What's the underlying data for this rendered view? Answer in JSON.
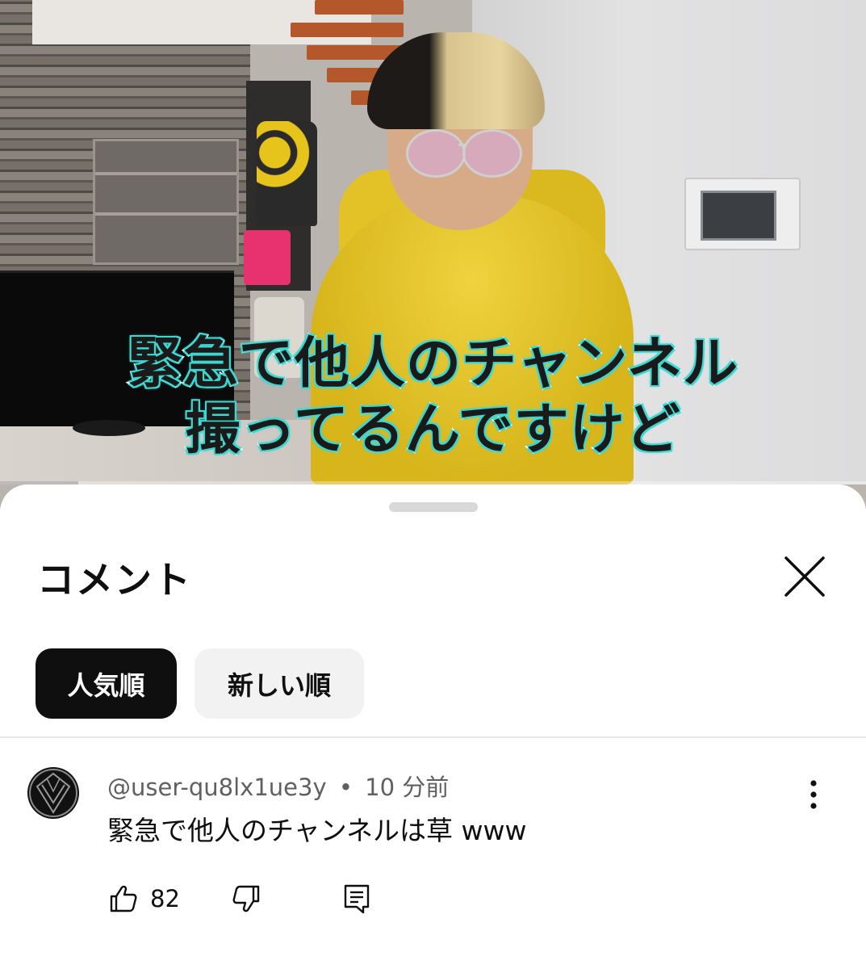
{
  "video": {
    "caption_line1": "緊急で他人のチャンネル",
    "caption_line2": "撮ってるんですけど",
    "progress": 0.09
  },
  "comments_panel": {
    "title": "コメント",
    "sort_chips": [
      {
        "label": "人気順",
        "selected": true
      },
      {
        "label": "新しい順",
        "selected": false
      }
    ],
    "comments": [
      {
        "author": "@user-qu8lx1ue3y",
        "separator": "•",
        "time": "10 分前",
        "text": "緊急で他人のチャンネルは草 www",
        "like_count": "82"
      }
    ]
  },
  "icons": {
    "close": "close-icon",
    "more": "more-vert-icon",
    "like": "thumbs-up-icon",
    "dislike": "thumbs-down-icon",
    "reply": "reply-comment-icon"
  },
  "colors": {
    "caption_outline": "#3fd7cf",
    "chip_active_bg": "#0f0f0f",
    "chip_inactive_bg": "#f2f2f2",
    "meta_text": "#606060"
  }
}
